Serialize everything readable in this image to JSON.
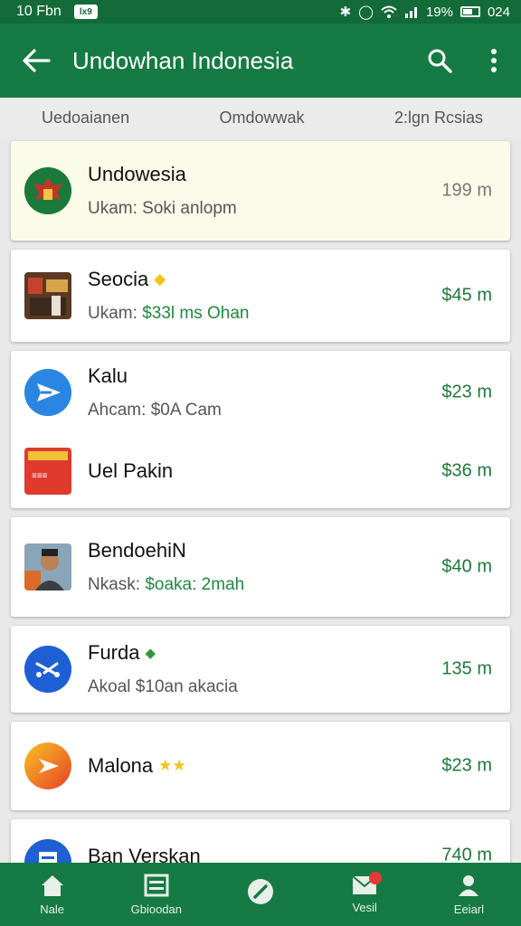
{
  "status_bar": {
    "time": "10 Fbn",
    "app_badge": "lx9",
    "battery_percent": "19%",
    "clock_right": "024"
  },
  "app_bar": {
    "title": "Undowhan Indonesia"
  },
  "tabs": [
    "Uedoaianen",
    "Omdowwak",
    "2:lgn Rcsias"
  ],
  "list": [
    {
      "title": "Undowesia",
      "subtitle": "Ukam: Soki anlopm",
      "amount": "199 m",
      "icon": "garuda-emblem-icon",
      "highlight": true
    },
    {
      "title": "Seocia",
      "subtitle_prefix": "Ukam: ",
      "subtitle_green": "$33l ms Ohan",
      "amount": "$45 m",
      "icon": "store-photo-icon",
      "badge": "star"
    },
    {
      "title": "Kalu",
      "subtitle": "Ahcam: $0A Cam",
      "amount": "$23 m",
      "icon": "send-icon"
    },
    {
      "title": "Uel Pakin",
      "amount": "$36 m",
      "icon": "shop-logo-icon"
    },
    {
      "title": "BendoehiN",
      "subtitle_prefix": "Nkask: ",
      "subtitle_green": "$oaka: 2mah",
      "amount": "$40 m",
      "icon": "person-photo-icon"
    },
    {
      "title": "Furda",
      "subtitle": "Akoal $10an akacia",
      "amount": "135 m",
      "icon": "transfer-icon",
      "badge": "leaf"
    },
    {
      "title": "Malona",
      "amount": "$23 m",
      "icon": "play-logo-icon",
      "badge": "stars"
    },
    {
      "title": "Ban Verskan",
      "amount": "740 m",
      "icon": "doc-icon"
    }
  ],
  "bottom_nav": [
    {
      "label": "Nale",
      "icon": "home-icon"
    },
    {
      "label": "Gbioodan",
      "icon": "list-icon"
    },
    {
      "label": "",
      "icon": "compass-icon"
    },
    {
      "label": "Vesil",
      "icon": "mail-icon"
    },
    {
      "label": "Eeiarl",
      "icon": "person-icon"
    }
  ],
  "colors": {
    "primary": "#157a43",
    "amount_green": "#1d7a39"
  }
}
